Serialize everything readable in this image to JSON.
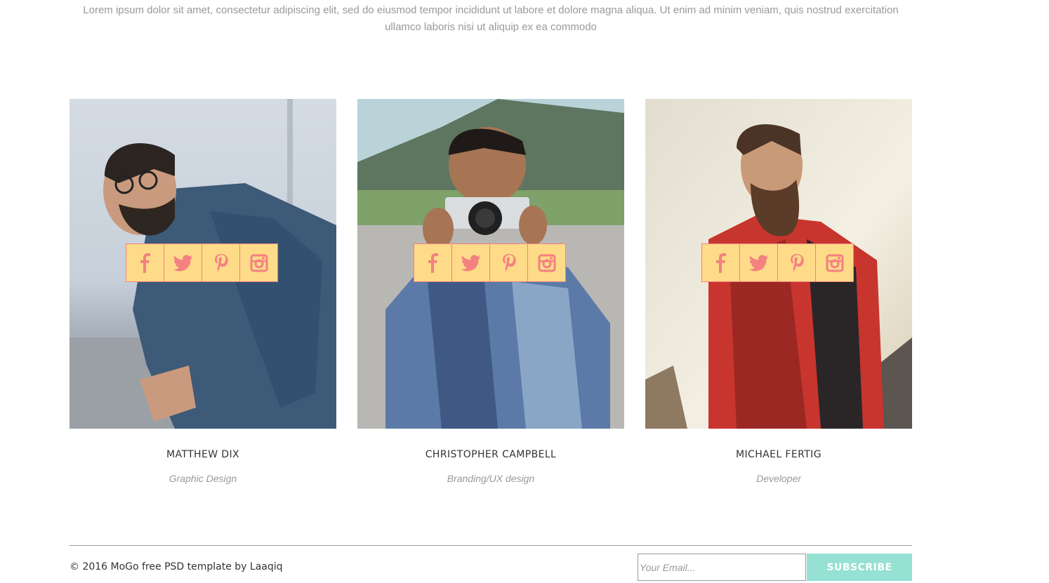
{
  "intro": {
    "text": "Lorem ipsum dolor sit amet, consectetur adipiscing elit, sed do eiusmod tempor incididunt ut labore et dolore magna aliqua. Ut enim ad minim veniam, quis nostrud exercitation ullamco laboris nisi ut aliquip ex ea commodo"
  },
  "team": [
    {
      "name": "MATTHEW DIX",
      "role": "Graphic Design"
    },
    {
      "name": "CHRISTOPHER CAMPBELL",
      "role": "Branding/UX design"
    },
    {
      "name": "MICHAEL FERTIG",
      "role": "Developer"
    }
  ],
  "social_icons": [
    "facebook-icon",
    "twitter-icon",
    "pinterest-icon",
    "instagram-icon"
  ],
  "colors": {
    "social_bg": "#fedb88",
    "social_border": "#f38181",
    "icon": "#f38181",
    "subscribe_bg": "#95e1d3"
  },
  "footer": {
    "copyright": "© 2016 MoGo free PSD template by Laaqiq",
    "email_placeholder": "Your Email...",
    "subscribe_label": "SUBSCRIBE"
  }
}
